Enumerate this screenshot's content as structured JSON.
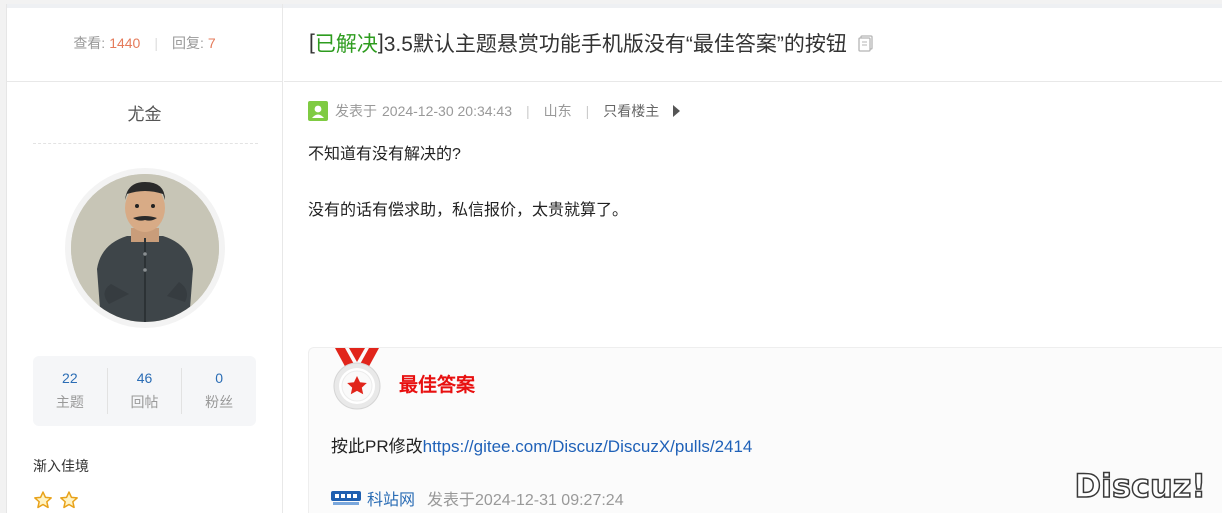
{
  "stats": {
    "views_label": "查看:",
    "views": "1440",
    "replies_label": "回复:",
    "replies": "7"
  },
  "thread": {
    "bracket_open": "[",
    "status": "已解决",
    "bracket_close": "]",
    "title": " 3.5默认主题悬赏功能手机版没有“最佳答案”的按钮"
  },
  "author": {
    "name": "尤金",
    "counts": [
      {
        "value": "22",
        "label": "主题"
      },
      {
        "value": "46",
        "label": "回帖"
      },
      {
        "value": "0",
        "label": "粉丝"
      }
    ],
    "level": "渐入佳境",
    "stars": 2
  },
  "post": {
    "posted_label": "发表于",
    "posted_at": "2024-12-30 20:34:43",
    "location": "山东",
    "only_author": "只看楼主",
    "paragraphs": [
      "不知道有没有解决的?",
      "没有的话有偿求助，私信报价，太贵就算了。"
    ]
  },
  "best_answer": {
    "heading": "最佳答案",
    "prefix": "按此PR修改",
    "link": "https://gitee.com/Discuz/DiscuzX/pulls/2414",
    "author": "科站网",
    "posted": "发表于2024-12-31 09:27:24"
  },
  "watermark": "Discuz!",
  "colors": {
    "solved": "#2e9c1f",
    "best_heading": "#e81010",
    "link": "#1f61b8",
    "stat_number": "#e57b5b"
  }
}
